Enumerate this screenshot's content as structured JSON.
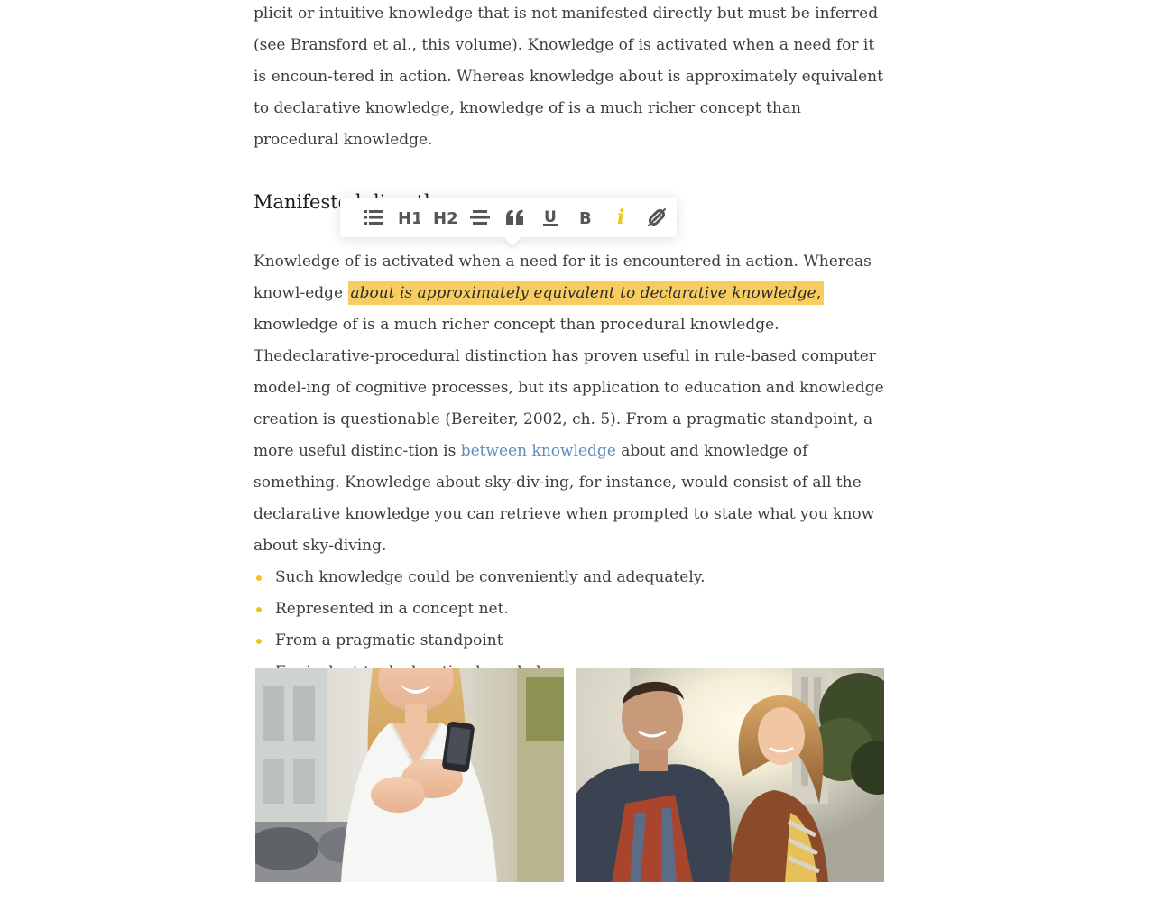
{
  "article": {
    "intro_paragraph": "plicit or intuitive knowledge that is not manifested directly but must be inferred (see Bransford et al., this volume). Knowledge of is activated when a need for it is encoun-tered in action. Whereas knowledge about is approximately equivalent to declarative knowledge, knowledge of is a much richer concept than procedural knowledge.",
    "heading": "Manifested directly",
    "selected_paragraph": {
      "before": "Knowledge of is activated when a need for it is encountered in action. Whereas knowl-edge ",
      "highlighted": "about is approximately equivalent to declarative knowledge,",
      "after": " knowledge of is a much richer concept than procedural knowledge."
    },
    "link_paragraph": {
      "before": "Thedeclarative-procedural distinction has proven useful in rule-based computer model-ing of cognitive processes, but its application to education and knowledge creation is questionable (Bereiter, 2002, ch. 5). From a pragmatic standpoint, a more useful distinc-tion is ",
      "link": "between knowledge",
      "after": " about and knowledge of something. Knowledge about sky-div-ing, for instance, would consist of all the declarative knowledge you can retrieve when prompted to state what you know about sky-diving."
    },
    "bullets": [
      "Such knowledge could be conveniently and adequately.",
      "Represented in a concept net.",
      "From a pragmatic standpoint",
      "Equivalent to declarative knowledge"
    ]
  },
  "toolbar": {
    "buttons": [
      {
        "icon": "list-icon",
        "label": "",
        "active": false
      },
      {
        "icon": "heading-1-icon",
        "label": "H1",
        "active": false
      },
      {
        "icon": "heading-2-icon",
        "label": "H2",
        "active": false
      },
      {
        "icon": "strikethrough-icon",
        "label": "",
        "active": false
      },
      {
        "icon": "quote-icon",
        "label": "",
        "active": false
      },
      {
        "icon": "underline-icon",
        "label": "U",
        "active": false
      },
      {
        "icon": "bold-icon",
        "label": "B",
        "active": false
      },
      {
        "icon": "italic-icon",
        "label": "i",
        "active": true
      },
      {
        "icon": "unlink-icon",
        "label": "",
        "active": false
      }
    ]
  },
  "colors": {
    "accent": "#f0c419",
    "highlight": "#f7cd62",
    "link": "#5b8ec1",
    "text": "#3d3d3d",
    "icon": "#555555"
  },
  "photos": [
    {
      "subject": "woman-with-smartphone-photo"
    },
    {
      "subject": "couple-walking-photo"
    }
  ]
}
